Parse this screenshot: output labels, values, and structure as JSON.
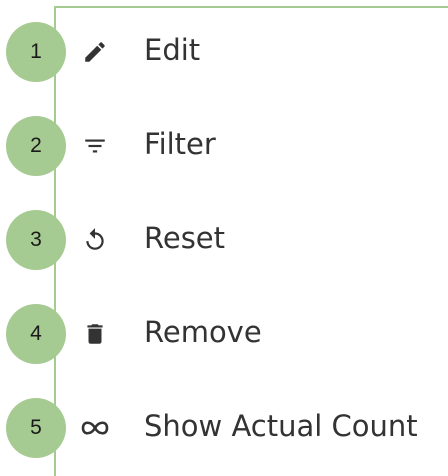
{
  "menu": {
    "items": [
      {
        "number": "1",
        "label": "Edit",
        "icon": "pencil-icon"
      },
      {
        "number": "2",
        "label": "Filter",
        "icon": "filter-icon"
      },
      {
        "number": "3",
        "label": "Reset",
        "icon": "reset-icon"
      },
      {
        "number": "4",
        "label": "Remove",
        "icon": "trash-icon"
      },
      {
        "number": "5",
        "label": "Show Actual Count",
        "icon": "infinity-icon"
      }
    ]
  },
  "colors": {
    "callout": "#a5cb92",
    "border": "#a5cb92",
    "text": "#333333",
    "icon": "#333333"
  }
}
